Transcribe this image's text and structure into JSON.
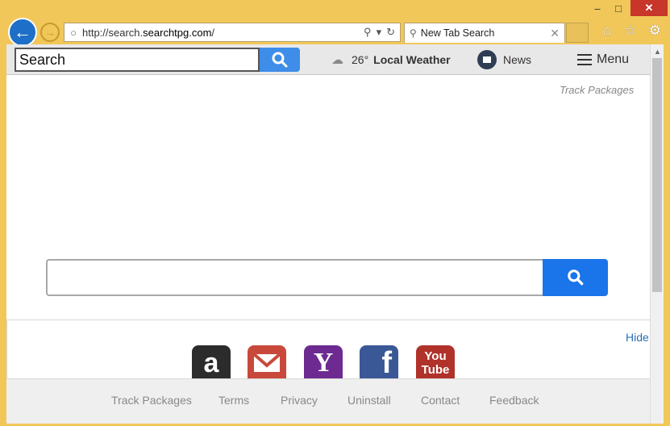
{
  "browser": {
    "url_prefix": "http://search.",
    "url_domain": "searchtpg.com",
    "url_suffix": "/",
    "tab_title": "New Tab Search",
    "window_buttons": {
      "minimize": "–",
      "maximize": "□",
      "close": "✕"
    }
  },
  "toolbar": {
    "search_placeholder": "Search",
    "weather_temp": "26°",
    "weather_label": "Local Weather",
    "news_label": "News",
    "menu_label": "Menu"
  },
  "page": {
    "track_packages_top": "Track Packages",
    "hide_label": "Hide",
    "tiles": [
      {
        "name": "Amazon",
        "glyph": "a",
        "color": "#2c2c2c"
      },
      {
        "name": "Gmail",
        "color": "#c8493b"
      },
      {
        "name": "Yahoo",
        "glyph": "Y",
        "color": "#6d2a90"
      },
      {
        "name": "Facebook",
        "glyph": "f",
        "color": "#3a5896"
      },
      {
        "name": "YouTube",
        "glyph_top": "You",
        "glyph_bottom": "Tube",
        "color": "#b0322a"
      }
    ]
  },
  "footer": {
    "links": [
      "Track Packages",
      "Terms",
      "Privacy",
      "Uninstall",
      "Contact",
      "Feedback"
    ]
  },
  "colors": {
    "frame": "#f1c75a",
    "search_button": "#1a74ea",
    "toolbar_search_button": "#3e8de9",
    "link": "#2a6fb5"
  }
}
